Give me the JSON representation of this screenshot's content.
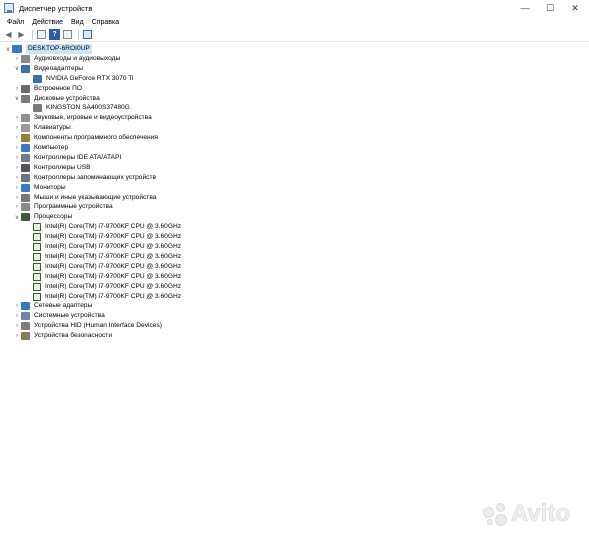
{
  "window": {
    "title": "Диспетчер устройств",
    "minimize": "—",
    "maximize": "☐",
    "close": "✕"
  },
  "menu": [
    "Файл",
    "Действие",
    "Вид",
    "Справка"
  ],
  "tree": {
    "root": "DESKTOP-6ROI0UP",
    "categories": [
      {
        "label": "Аудиовходы и аудиовыходы",
        "icon": "speaker-icon",
        "expanded": false
      },
      {
        "label": "Видеоадаптеры",
        "icon": "display-adapter-icon",
        "expanded": true,
        "children": [
          "NVIDIA GeForce RTX 3070 Ti"
        ]
      },
      {
        "label": "Встроенное ПО",
        "icon": "firmware-icon",
        "expanded": false
      },
      {
        "label": "Дисковые устройства",
        "icon": "disk-drive-icon",
        "expanded": true,
        "children": [
          "KINGSTON SA400S37480G"
        ]
      },
      {
        "label": "Звуковые, игровые и видеоустройства",
        "icon": "sound-icon",
        "expanded": false
      },
      {
        "label": "Клавиатуры",
        "icon": "keyboard-icon",
        "expanded": false
      },
      {
        "label": "Компоненты программного обеспечения",
        "icon": "software-component-icon",
        "expanded": false
      },
      {
        "label": "Компьютер",
        "icon": "computer-icon",
        "expanded": false
      },
      {
        "label": "Контроллеры IDE ATA/ATAPI",
        "icon": "ide-controller-icon",
        "expanded": false
      },
      {
        "label": "Контроллеры USB",
        "icon": "usb-icon",
        "expanded": false
      },
      {
        "label": "Контроллеры запоминающих устройств",
        "icon": "storage-controller-icon",
        "expanded": false
      },
      {
        "label": "Мониторы",
        "icon": "monitor-icon",
        "expanded": false
      },
      {
        "label": "Мыши и иные указывающие устройства",
        "icon": "mouse-icon",
        "expanded": false
      },
      {
        "label": "Программные устройства",
        "icon": "software-device-icon",
        "expanded": false
      },
      {
        "label": "Процессоры",
        "icon": "processor-icon",
        "expanded": true,
        "children": [
          "Intel(R) Core(TM) i7-9700KF CPU @ 3.60GHz",
          "Intel(R) Core(TM) i7-9700KF CPU @ 3.60GHz",
          "Intel(R) Core(TM) i7-9700KF CPU @ 3.60GHz",
          "Intel(R) Core(TM) i7-9700KF CPU @ 3.60GHz",
          "Intel(R) Core(TM) i7-9700KF CPU @ 3.60GHz",
          "Intel(R) Core(TM) i7-9700KF CPU @ 3.60GHz",
          "Intel(R) Core(TM) i7-9700KF CPU @ 3.60GHz",
          "Intel(R) Core(TM) i7-9700KF CPU @ 3.60GHz"
        ]
      },
      {
        "label": "Сетевые адаптеры",
        "icon": "network-adapter-icon",
        "expanded": false
      },
      {
        "label": "Системные устройства",
        "icon": "system-device-icon",
        "expanded": false
      },
      {
        "label": "Устройства HID (Human Interface Devices)",
        "icon": "hid-icon",
        "expanded": false
      },
      {
        "label": "Устройства безопасности",
        "icon": "security-device-icon",
        "expanded": false
      }
    ]
  },
  "watermark": "Avito",
  "colors": {
    "selection": "#cce4f7",
    "cpu": "#3f5a3a"
  }
}
